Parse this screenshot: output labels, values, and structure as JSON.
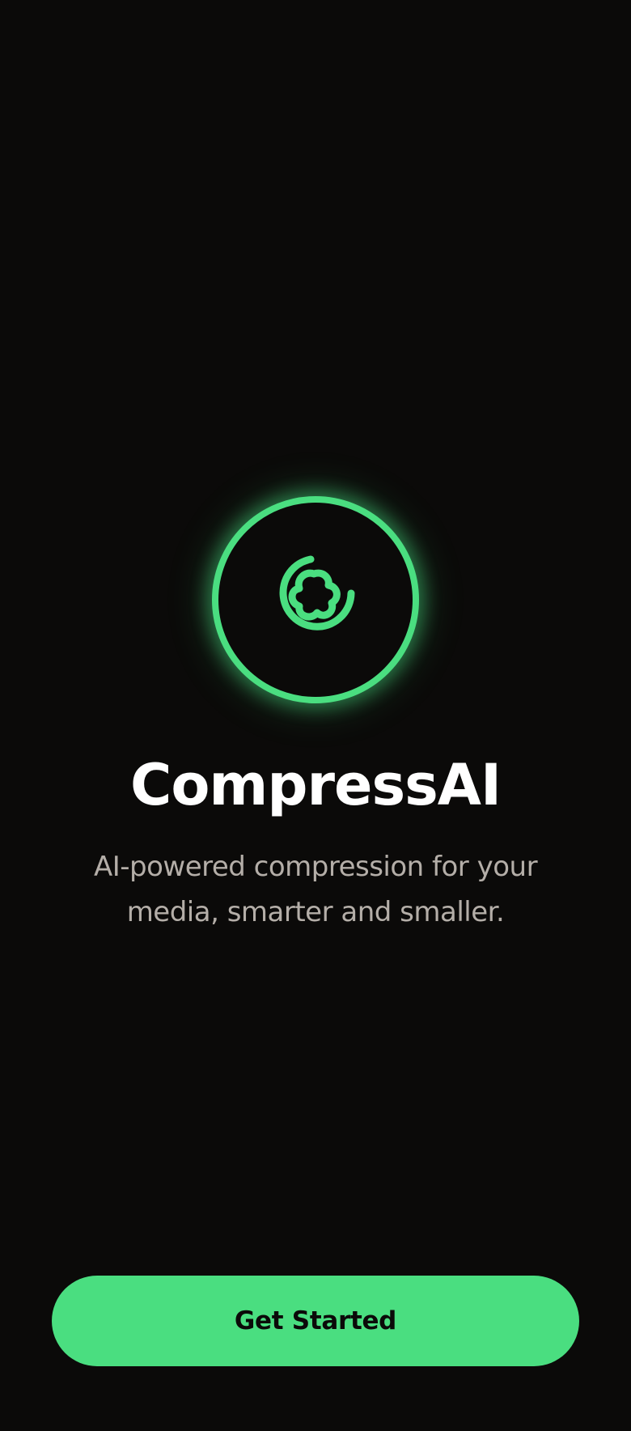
{
  "app": {
    "title": "CompressAI",
    "tagline": "AI-powered compression for your media, smarter and smaller."
  },
  "logo": {
    "icon": "compress-swirl-icon",
    "accent_color": "#4ade80"
  },
  "actions": {
    "get_started_label": "Get Started"
  },
  "theme": {
    "background": "#0b0a09",
    "accent": "#4ade80",
    "title_color": "#ffffff",
    "tagline_color": "#b4aea8"
  }
}
